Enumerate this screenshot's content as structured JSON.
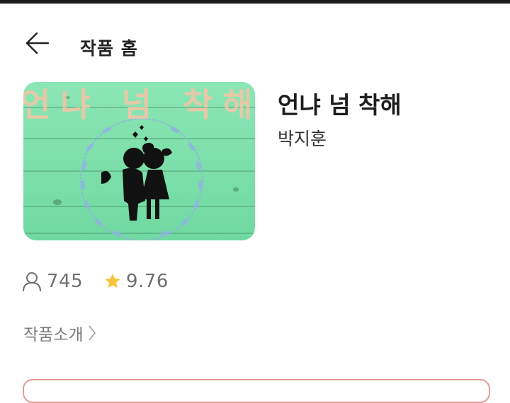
{
  "header": {
    "title": "작품 홈",
    "back_icon": "arrow-left-icon"
  },
  "work": {
    "title": "언냐 넘 착해",
    "author": "박지훈",
    "cover_text": "언냐 넘 착해",
    "cover_colors": {
      "wood": "#7fe3ad",
      "wreath": "#8fb4e0",
      "text": "#f5c3a6"
    }
  },
  "stats": {
    "views": "745",
    "views_icon": "user-icon",
    "rating": "9.76",
    "rating_icon": "star-icon",
    "star_color": "#f7c53b"
  },
  "intro": {
    "label": "작품소개",
    "icon": "chevron-right-icon"
  },
  "colors": {
    "accent_border": "#e39a93"
  }
}
